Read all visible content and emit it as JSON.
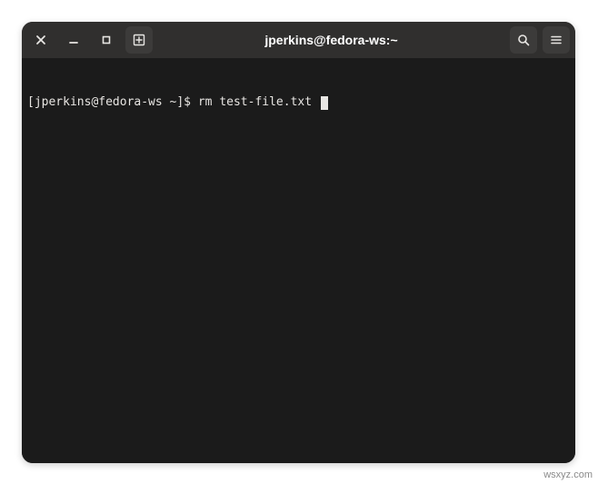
{
  "window": {
    "title": "jperkins@fedora-ws:~"
  },
  "titlebar": {
    "close_icon": "close",
    "minimize_icon": "minimize",
    "maximize_icon": "maximize",
    "newtab_icon": "new-tab",
    "search_icon": "search",
    "menu_icon": "menu"
  },
  "terminal": {
    "lines": [
      {
        "prompt": "[jperkins@fedora-ws ~]$ ",
        "command": "rm test-file.txt "
      }
    ]
  },
  "watermark": "wsxyz.com"
}
